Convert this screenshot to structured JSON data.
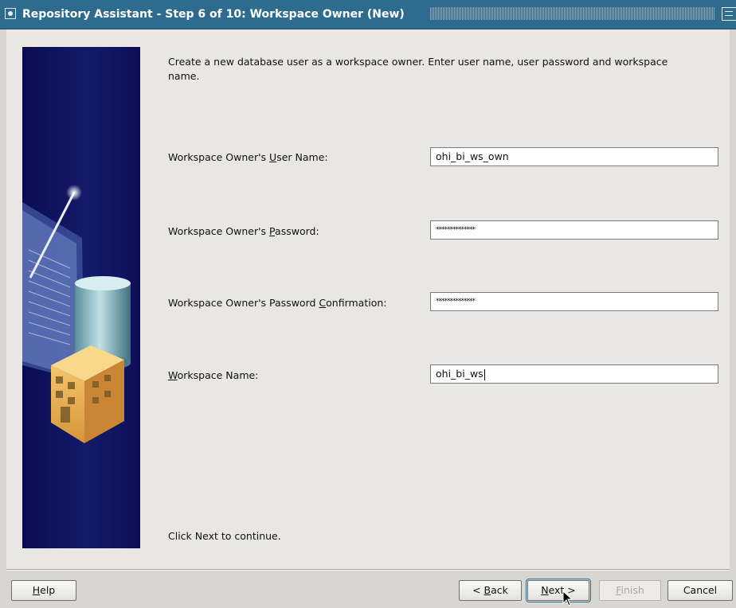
{
  "window": {
    "title": "Repository Assistant - Step 6 of 10: Workspace Owner (New)"
  },
  "intro_text": "Create a new database user as a workspace owner. Enter user name, user password and workspace name.",
  "fields": [
    {
      "label_pre": "Workspace Owner's ",
      "label_mnemonic": "U",
      "label_post": "ser Name:",
      "value": "ohi_bi_ws_own",
      "type": "text"
    },
    {
      "label_pre": "Workspace Owner's ",
      "label_mnemonic": "P",
      "label_post": "assword:",
      "value": "**************",
      "type": "password"
    },
    {
      "label_pre": "Workspace Owner's Password ",
      "label_mnemonic": "C",
      "label_post": "onfirmation:",
      "value": "**************",
      "type": "password"
    },
    {
      "label_pre": "",
      "label_mnemonic": "W",
      "label_post": "orkspace Name:",
      "value": "ohi_bi_ws",
      "type": "text"
    }
  ],
  "footer_text": "Click Next to continue.",
  "buttons": {
    "help": {
      "mnemonic": "H",
      "rest": "elp"
    },
    "back": {
      "pre": "< ",
      "mnemonic": "B",
      "rest": "ack"
    },
    "next": {
      "mnemonic": "N",
      "rest": "ext >"
    },
    "finish": {
      "mnemonic": "F",
      "rest": "inish"
    },
    "cancel": {
      "label": "Cancel"
    }
  },
  "colors": {
    "titlebar": "#2e6c8f",
    "side_panel": "#0b0c52",
    "dialog_bg": "#e8e7e4"
  },
  "icons": {
    "window_menu": "window-menu-icon",
    "maximize": "maximize-icon",
    "wizard_art": "database-building-wand-illustration",
    "cursor": "mouse-pointer-icon"
  }
}
